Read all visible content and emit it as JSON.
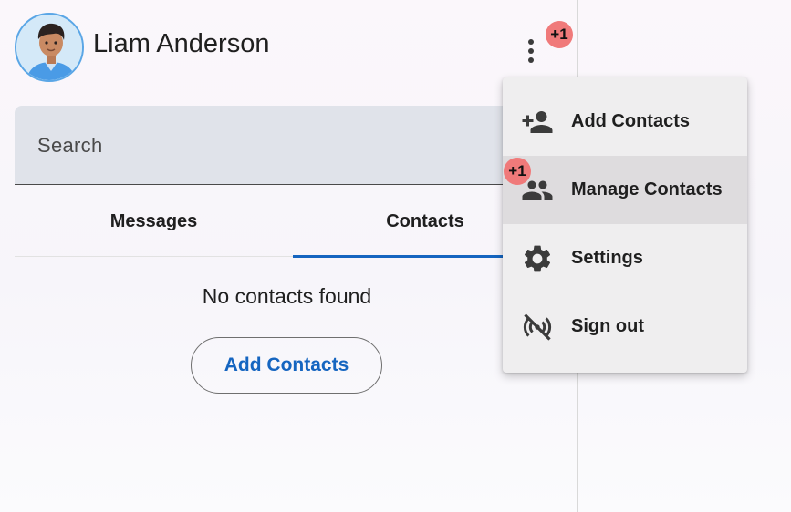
{
  "header": {
    "user_name": "Liam Anderson",
    "notification_badge": "+1"
  },
  "search": {
    "label": "Search"
  },
  "tabs": [
    {
      "label": "Messages",
      "selected": false
    },
    {
      "label": "Contacts",
      "selected": true
    }
  ],
  "contacts_panel": {
    "empty_message": "No contacts found",
    "add_button_label": "Add Contacts"
  },
  "menu": {
    "items": [
      {
        "label": "Add Contacts",
        "icon": "person-add-icon"
      },
      {
        "label": "Manage Contacts",
        "icon": "group-icon",
        "badge": "+1",
        "highlighted": true
      },
      {
        "label": "Settings",
        "icon": "gear-icon"
      },
      {
        "label": "Sign out",
        "icon": "signal-off-icon"
      }
    ]
  },
  "colors": {
    "accent": "#1565c0",
    "badge": "#f07a7a",
    "search_bg": "#e0e3ea",
    "menu_bg": "#efeeef"
  }
}
